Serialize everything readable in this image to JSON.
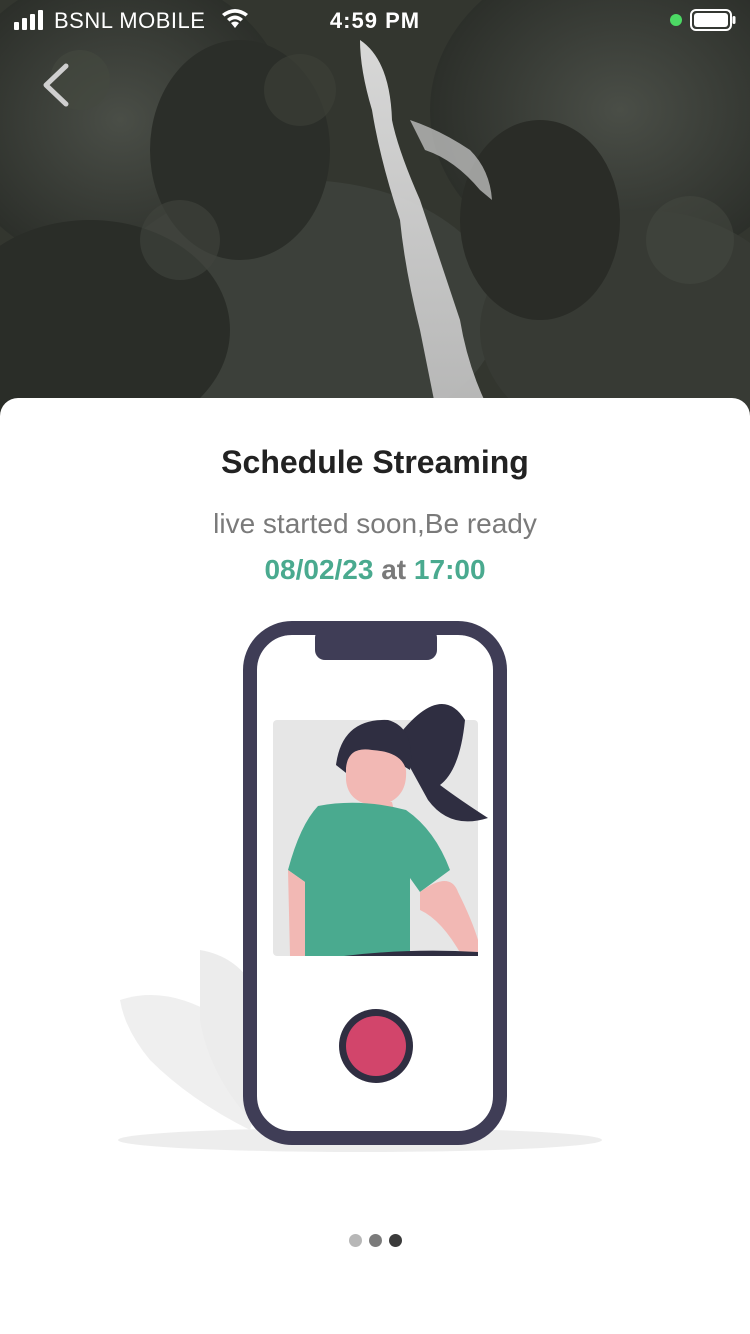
{
  "status_bar": {
    "carrier": "BSNL MOBILE",
    "time": "4:59 PM"
  },
  "nav": {
    "back_icon": "chevron-left-icon"
  },
  "card": {
    "title": "Schedule Streaming",
    "subtitle": "live started soon,Be ready",
    "date": "08/02/23",
    "at": "at",
    "time": "17:00"
  },
  "pager": {
    "count": 3
  },
  "colors": {
    "accent": "#4aaa8f",
    "record": "#d2456b",
    "phone_frame": "#3f3d56",
    "shirt": "#4aaa8f",
    "skin": "#f2b8b4"
  }
}
